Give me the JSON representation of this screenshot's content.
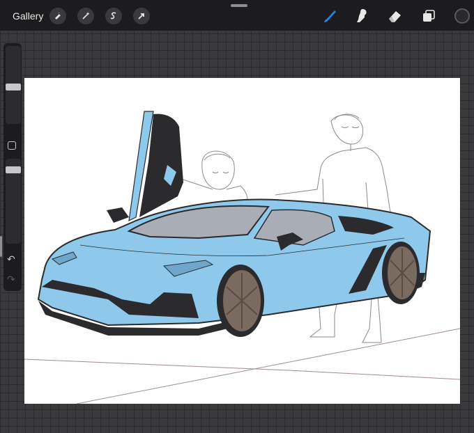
{
  "toolbar": {
    "gallery_label": "Gallery",
    "left_tools": [
      "wrench-icon",
      "magic-wand-icon",
      "selection-icon",
      "transform-arrow-icon"
    ],
    "right_tools": [
      "brush-icon",
      "smudge-icon",
      "eraser-icon",
      "layers-icon"
    ],
    "active_tool": "brush-icon",
    "active_color": "#2a7de1",
    "current_color": "#2a2a2c"
  },
  "sidebar": {
    "brush_size": 0.4,
    "opacity": 0.3,
    "undo_icon": "↶",
    "redo_icon": "↷"
  },
  "canvas": {
    "colors": {
      "car_body": "#8ec9ec",
      "car_dark": "#2b2b2d",
      "window": "#a9adb6",
      "wheel": "#7b6a60",
      "light": "#6ea6cc",
      "sketch": "#8a8a8a"
    }
  }
}
